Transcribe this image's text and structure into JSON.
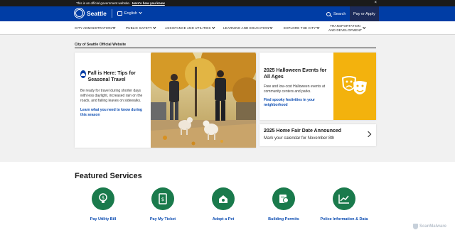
{
  "gov_banner": {
    "text": "This is an official government website.",
    "link": "Here's how you know",
    "close": "×"
  },
  "header": {
    "site_name": "Seattle",
    "language": "English",
    "search_label": "Search",
    "pay_label": "Pay or Apply"
  },
  "nav": {
    "items": [
      {
        "label": "CITY ADMINISTRATION"
      },
      {
        "label": "PUBLIC SAFETY"
      },
      {
        "label": "ASSISTANCE AND UTILITIES"
      },
      {
        "label": "LEARNING AND EDUCATION"
      },
      {
        "label": "EXPLORE THE CITY"
      },
      {
        "label_line1": "TRANSPORTATION",
        "label_line2": "AND DEVELOPMENT"
      }
    ]
  },
  "page_title": "City of Seattle Official Website",
  "feature": {
    "title": "Fall is Here: Tips for Seasonal Travel",
    "body": "Be ready for travel during shorter days with less daylight, increased rain on the roads, and failing leaves on sidewalks.",
    "link": "Learn what you need to know during this season",
    "icon": "weather-icon"
  },
  "halloween": {
    "title": "2025 Halloween Events for All Ages",
    "body": "Free and low-cost Halloween events at community centers and parks.",
    "link": "Find spooky festivities in your neighborhood",
    "icon": "theater-masks-icon",
    "color": "#f3b20d"
  },
  "fair": {
    "title": "2025 Home Fair Date Announced",
    "body": "Mark your calendar for November 8th"
  },
  "services": {
    "title": "Featured Services",
    "items": [
      {
        "label": "Pay Utility Bill",
        "icon": "lightbulb-dollar-icon"
      },
      {
        "label": "Pay My Ticket",
        "icon": "ticket-dollar-icon"
      },
      {
        "label": "Adopt a Pet",
        "icon": "pet-house-icon"
      },
      {
        "label": "Building Permits",
        "icon": "permit-icon"
      },
      {
        "label": "Police Information & Data",
        "icon": "chart-icon"
      }
    ],
    "color": "#1a7a4c"
  },
  "watermark": "ScanMalware"
}
